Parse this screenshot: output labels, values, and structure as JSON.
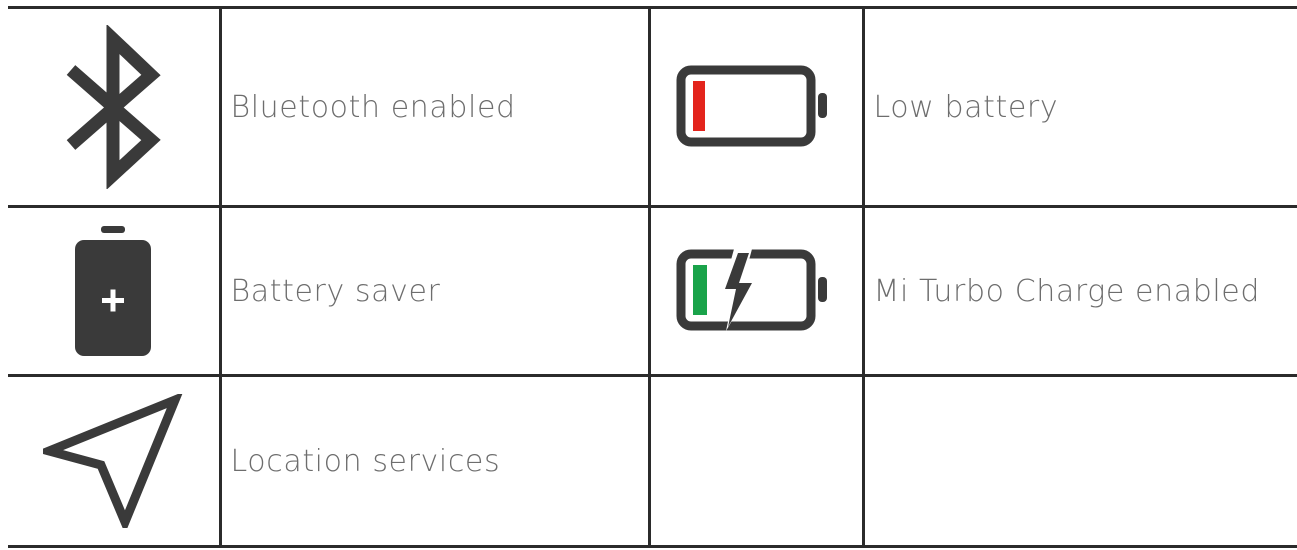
{
  "icons": {
    "bluetooth": "bluetooth-icon",
    "low_battery": "low-battery-icon",
    "battery_saver": "battery-saver-icon",
    "turbo_charge": "battery-charging-icon",
    "location": "location-arrow-icon"
  },
  "colors": {
    "icon_dark": "#3a3a3a",
    "low_battery_red": "#e3241c",
    "charge_green": "#1aa34a",
    "label_text": "#6d6d6d",
    "border": "#2b2b2b"
  },
  "rows": [
    {
      "left_label": "Bluetooth enabled",
      "right_label": "Low battery"
    },
    {
      "left_label": "Battery saver",
      "right_label": "Mi Turbo Charge enabled"
    },
    {
      "left_label": "Location services",
      "right_label": ""
    }
  ]
}
